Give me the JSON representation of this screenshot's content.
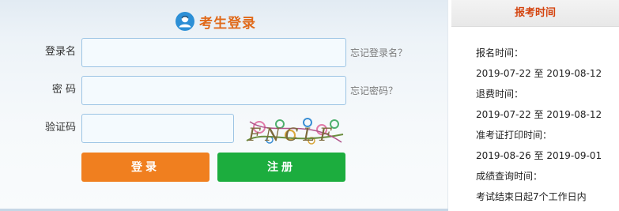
{
  "login": {
    "title": "考生登录",
    "username_label": "登录名",
    "username_value": "",
    "forgot_username": "忘记登录名？",
    "password_label": "密 码",
    "password_value": "",
    "forgot_password": "忘记密码？",
    "captcha_label": "验证码",
    "captcha_value": "",
    "captcha_text": "FNCLF",
    "login_button": "登录",
    "register_button": "注册"
  },
  "schedule": {
    "header": "报考时间",
    "lines": [
      "报名时间：",
      "2019-07-22 至 2019-08-12",
      "退费时间：",
      "2019-07-22 至 2019-08-12",
      "准考证打印时间：",
      "2019-08-26 至 2019-09-01",
      "成绩查询时间：",
      "考试结束日起7个工作日内"
    ]
  },
  "colors": {
    "accent_orange": "#f07f1f",
    "accent_green": "#1cad3e",
    "title_orange": "#e06a1b",
    "header_red": "#d4440f"
  }
}
